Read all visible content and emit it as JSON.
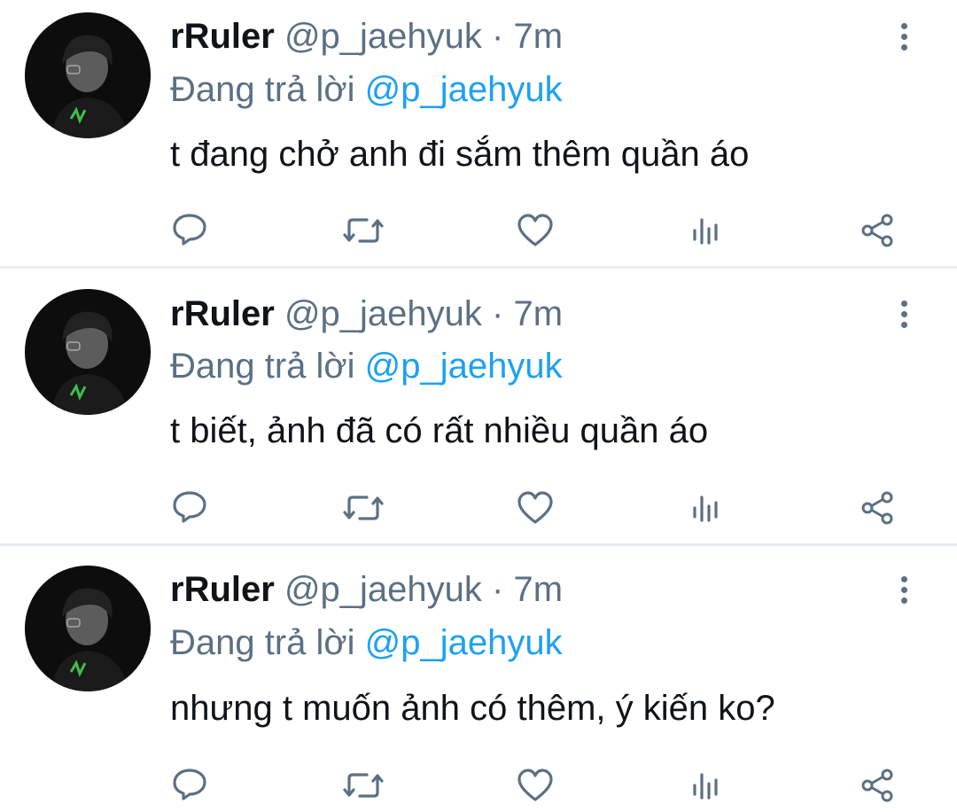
{
  "tweets": [
    {
      "name": "rRuler",
      "handle": "@p_jaehyuk",
      "separator": "·",
      "time": "7m",
      "reply_prefix": "Đang trả lời",
      "reply_to": "@p_jaehyuk",
      "text": "t đang chở anh đi sắm thêm quần áo"
    },
    {
      "name": "rRuler",
      "handle": "@p_jaehyuk",
      "separator": "·",
      "time": "7m",
      "reply_prefix": "Đang trả lời",
      "reply_to": "@p_jaehyuk",
      "text": "t biết, ảnh đã có rất nhiều quần áo"
    },
    {
      "name": "rRuler",
      "handle": "@p_jaehyuk",
      "separator": "·",
      "time": "7m",
      "reply_prefix": "Đang trả lời",
      "reply_to": "@p_jaehyuk",
      "text": "nhưng t muốn ảnh có thêm, ý kiến ko?"
    }
  ],
  "icons": {
    "reply": "reply-icon",
    "retweet": "retweet-icon",
    "like": "heart-icon",
    "analytics": "analytics-icon",
    "share": "share-icon",
    "more": "more-vertical-icon"
  },
  "colors": {
    "text": "#0f1419",
    "secondary": "#5b7083",
    "mention": "#1da1f2",
    "divider": "#e6ecf0"
  }
}
